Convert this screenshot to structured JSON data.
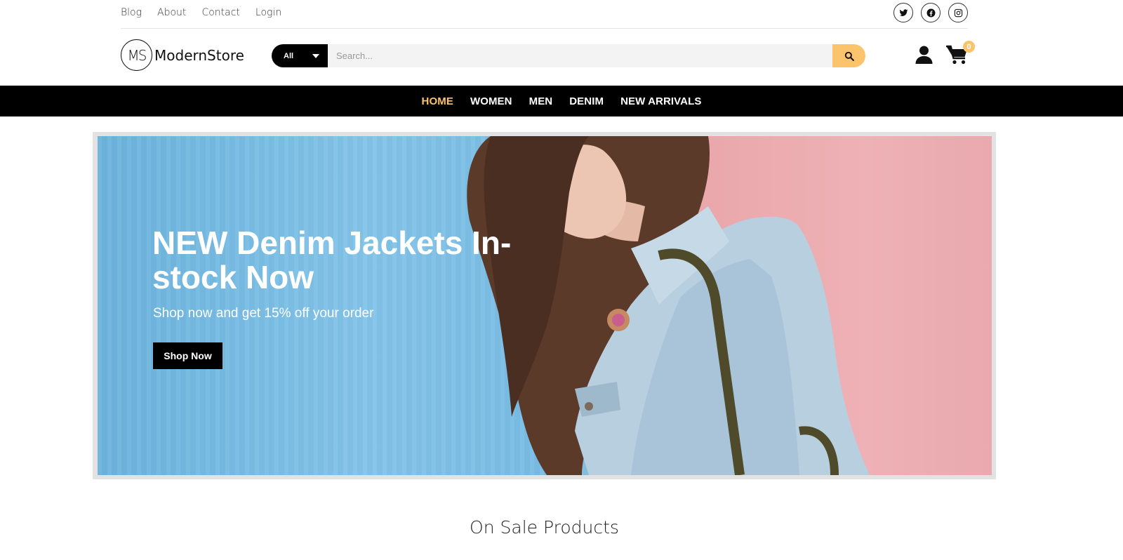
{
  "top_links": [
    "Blog",
    "About",
    "Contact",
    "Login"
  ],
  "socials": [
    {
      "icon": "twitter-icon"
    },
    {
      "icon": "facebook-icon"
    },
    {
      "icon": "instagram-icon"
    }
  ],
  "logo": {
    "mark": "MS",
    "name": "ModernStore"
  },
  "search": {
    "category": "All",
    "placeholder": "Search...",
    "value": ""
  },
  "cart": {
    "count": "0"
  },
  "nav": [
    {
      "label": "HOME",
      "active": true
    },
    {
      "label": "WOMEN",
      "active": false
    },
    {
      "label": "MEN",
      "active": false
    },
    {
      "label": "DENIM",
      "active": false
    },
    {
      "label": "NEW ARRIVALS",
      "active": false
    }
  ],
  "hero": {
    "title": "NEW Denim Jackets In-stock Now",
    "subtitle": "Shop now and get 15% off your order",
    "button": "Shop Now"
  },
  "section": {
    "title": "On Sale Products"
  },
  "colors": {
    "accent": "#fbc36b",
    "nav_bg": "#000000",
    "text": "#222222"
  }
}
